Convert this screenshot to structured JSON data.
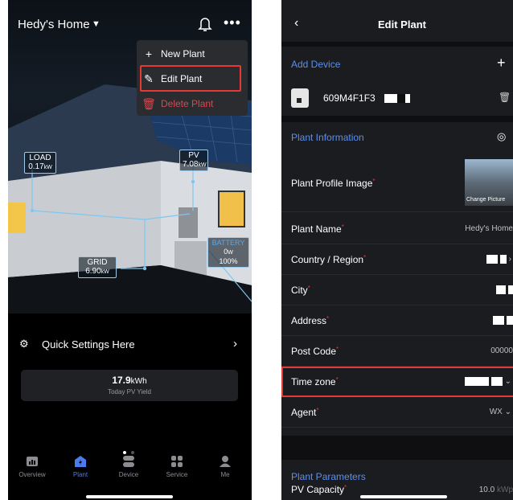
{
  "left": {
    "home_name": "Hedy's Home",
    "menu": {
      "new_plant": "New Plant",
      "edit_plant": "Edit Plant",
      "delete_plant": "Delete Plant"
    },
    "flows": {
      "load": {
        "name": "LOAD",
        "value": "0.17",
        "unit": "kW"
      },
      "pv": {
        "name": "PV",
        "value": "7.08",
        "unit": "kW"
      },
      "grid": {
        "name": "GRID",
        "value": "6.90",
        "unit": "kW"
      },
      "battery": {
        "name": "BATTERY",
        "value": "0",
        "unit": "W",
        "soc": "100%"
      }
    },
    "quick_settings": "Quick Settings Here",
    "yield": {
      "value": "17.9",
      "unit": "kWh",
      "label": "Today PV Yield"
    },
    "tabs": [
      {
        "label": "Overview",
        "icon": "overview-icon"
      },
      {
        "label": "Plant",
        "icon": "plant-icon"
      },
      {
        "label": "Device",
        "icon": "device-icon"
      },
      {
        "label": "Service",
        "icon": "service-icon"
      },
      {
        "label": "Me",
        "icon": "me-icon"
      }
    ],
    "accent_color": "#4a7cf0",
    "highlight_color": "#e53935"
  },
  "right": {
    "title": "Edit Plant",
    "add_device": "Add Device",
    "device_sn": "609M4F1F3",
    "plant_information": "Plant Information",
    "profile_image_label": "Plant Profile Image",
    "change_picture": "Change Picture",
    "fields": {
      "plant_name": {
        "label": "Plant Name",
        "value": "Hedy's Home"
      },
      "country": {
        "label": "Country / Region"
      },
      "city": {
        "label": "City"
      },
      "address": {
        "label": "Address"
      },
      "post_code": {
        "label": "Post Code",
        "value": "00000"
      },
      "time_zone": {
        "label": "Time zone"
      },
      "agent": {
        "label": "Agent",
        "value": "WX"
      }
    },
    "plant_parameters": "Plant Parameters",
    "pv_capacity": {
      "label": "PV Capacity",
      "value": "10.0",
      "unit": "kWp"
    },
    "required_mark": "*"
  }
}
